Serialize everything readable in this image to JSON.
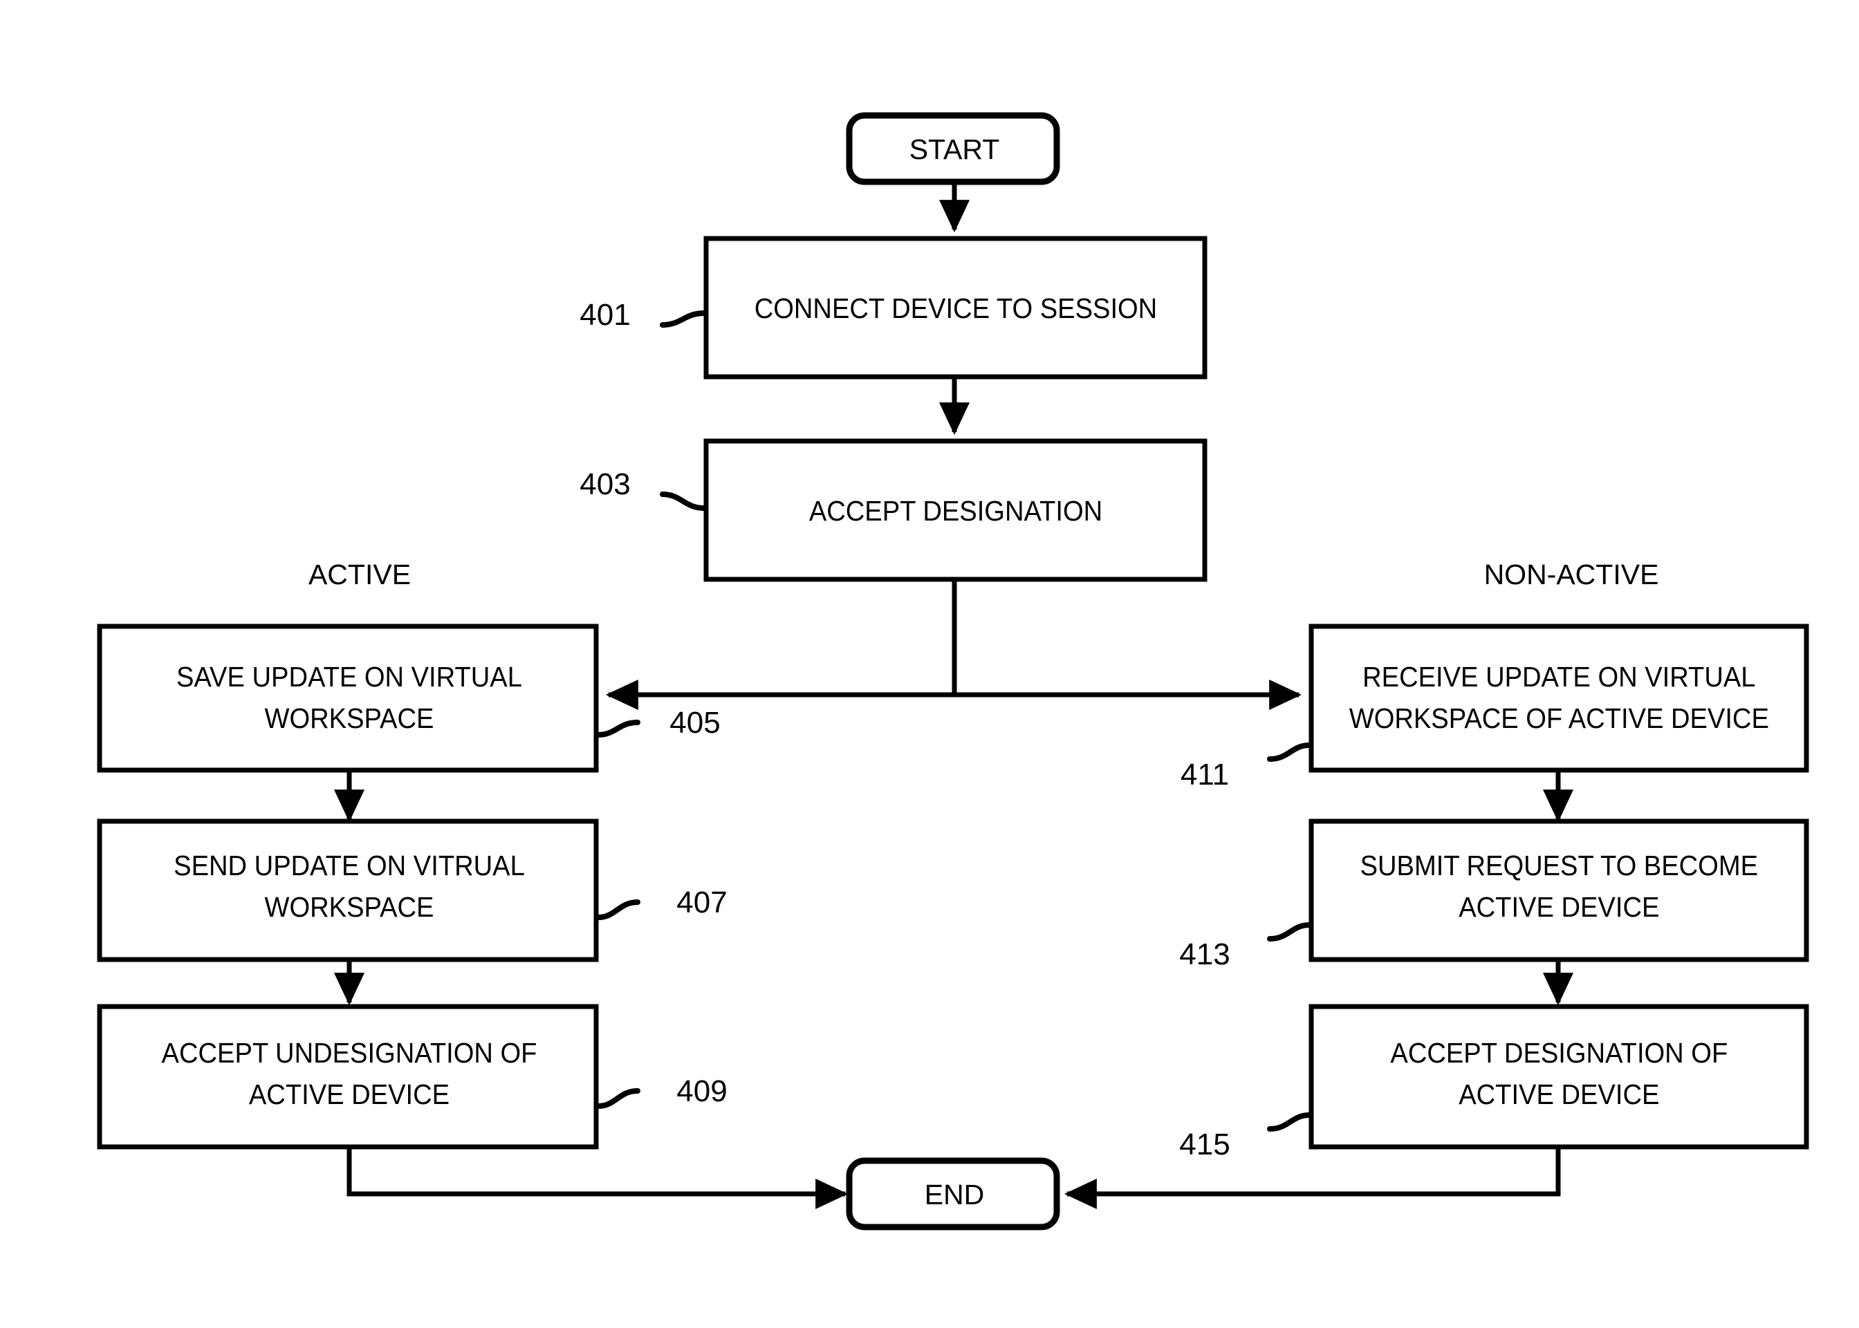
{
  "figure": {
    "type": "patent-flowchart",
    "terminators": {
      "start": "START",
      "end": "END"
    },
    "branch_labels": {
      "left": "ACTIVE",
      "right": "NON-ACTIVE"
    },
    "nodes": [
      {
        "id": "connect",
        "ref": "401",
        "lines": [
          "CONNECT DEVICE TO SESSION"
        ],
        "column": "center"
      },
      {
        "id": "accept_designation",
        "ref": "403",
        "lines": [
          "ACCEPT DESIGNATION"
        ],
        "column": "center"
      },
      {
        "id": "save_update",
        "ref": "405",
        "lines": [
          "SAVE UPDATE ON VIRTUAL",
          "WORKSPACE"
        ],
        "column": "left"
      },
      {
        "id": "send_update",
        "ref": "407",
        "lines": [
          "SEND UPDATE ON VITRUAL",
          "WORKSPACE"
        ],
        "column": "left"
      },
      {
        "id": "accept_undesignation",
        "ref": "409",
        "lines": [
          "ACCEPT UNDESIGNATION OF",
          "ACTIVE DEVICE"
        ],
        "column": "left"
      },
      {
        "id": "receive_update",
        "ref": "411",
        "lines": [
          "RECEIVE UPDATE ON VIRTUAL",
          "WORKSPACE OF ACTIVE DEVICE"
        ],
        "column": "right"
      },
      {
        "id": "submit_request",
        "ref": "413",
        "lines": [
          "SUBMIT REQUEST TO BECOME",
          "ACTIVE DEVICE"
        ],
        "column": "right"
      },
      {
        "id": "accept_designation_active",
        "ref": "415",
        "lines": [
          "ACCEPT DESIGNATION OF",
          "ACTIVE DEVICE"
        ],
        "column": "right"
      }
    ],
    "colors": {
      "stroke": "#000000",
      "fill": "#ffffff",
      "text": "#000000"
    }
  }
}
